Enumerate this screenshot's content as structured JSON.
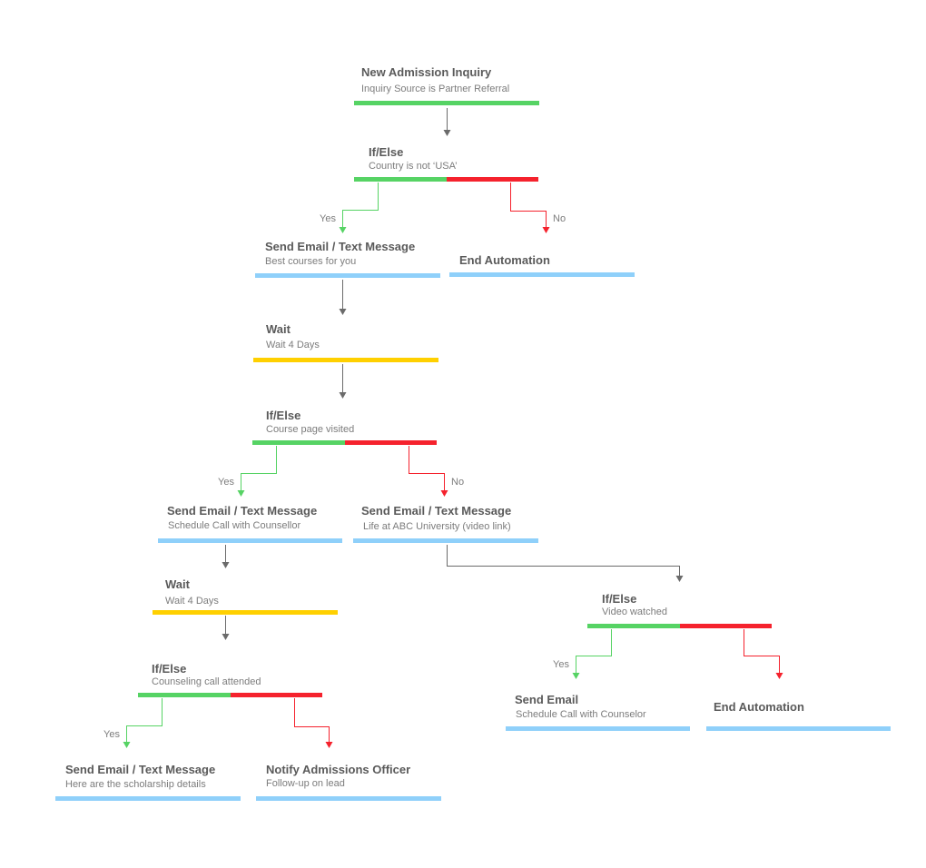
{
  "nodes": {
    "n1": {
      "title": "New Admission Inquiry",
      "sub": "Inquiry Source is Partner Referral"
    },
    "n2": {
      "title": "If/Else",
      "sub": "Country is not ‘USA’"
    },
    "n3": {
      "title": "Send Email / Text Message",
      "sub": "Best courses for you"
    },
    "n4": {
      "title": "End Automation"
    },
    "n5": {
      "title": "Wait",
      "sub": "Wait 4 Days"
    },
    "n6": {
      "title": "If/Else",
      "sub": "Course page visited"
    },
    "n7": {
      "title": "Send Email  / Text Message",
      "sub": "Schedule Call with Counsellor"
    },
    "n8": {
      "title": "Send Email / Text Message",
      "sub": "Life at ABC University (video link)"
    },
    "n9": {
      "title": "Wait",
      "sub": "Wait 4 Days"
    },
    "n10": {
      "title": "If/Else",
      "sub": "Video watched"
    },
    "n11": {
      "title": "If/Else",
      "sub": "Counseling call attended"
    },
    "n12": {
      "title": "Send Email",
      "sub": "Schedule Call with Counselor"
    },
    "n13": {
      "title": "End Automation"
    },
    "n14": {
      "title": "Send Email / Text Message",
      "sub": "Here are the scholarship details"
    },
    "n15": {
      "title": "Notify Admissions Officer",
      "sub": "Follow-up on lead"
    }
  },
  "branch_labels": {
    "yes": "Yes",
    "no": "No"
  },
  "colors": {
    "trigger": "#56d364",
    "action": "#8fd0fa",
    "wait": "#ffd000",
    "yes": "#56d364",
    "no": "#f5222d",
    "connector": "#6b6b6b"
  }
}
